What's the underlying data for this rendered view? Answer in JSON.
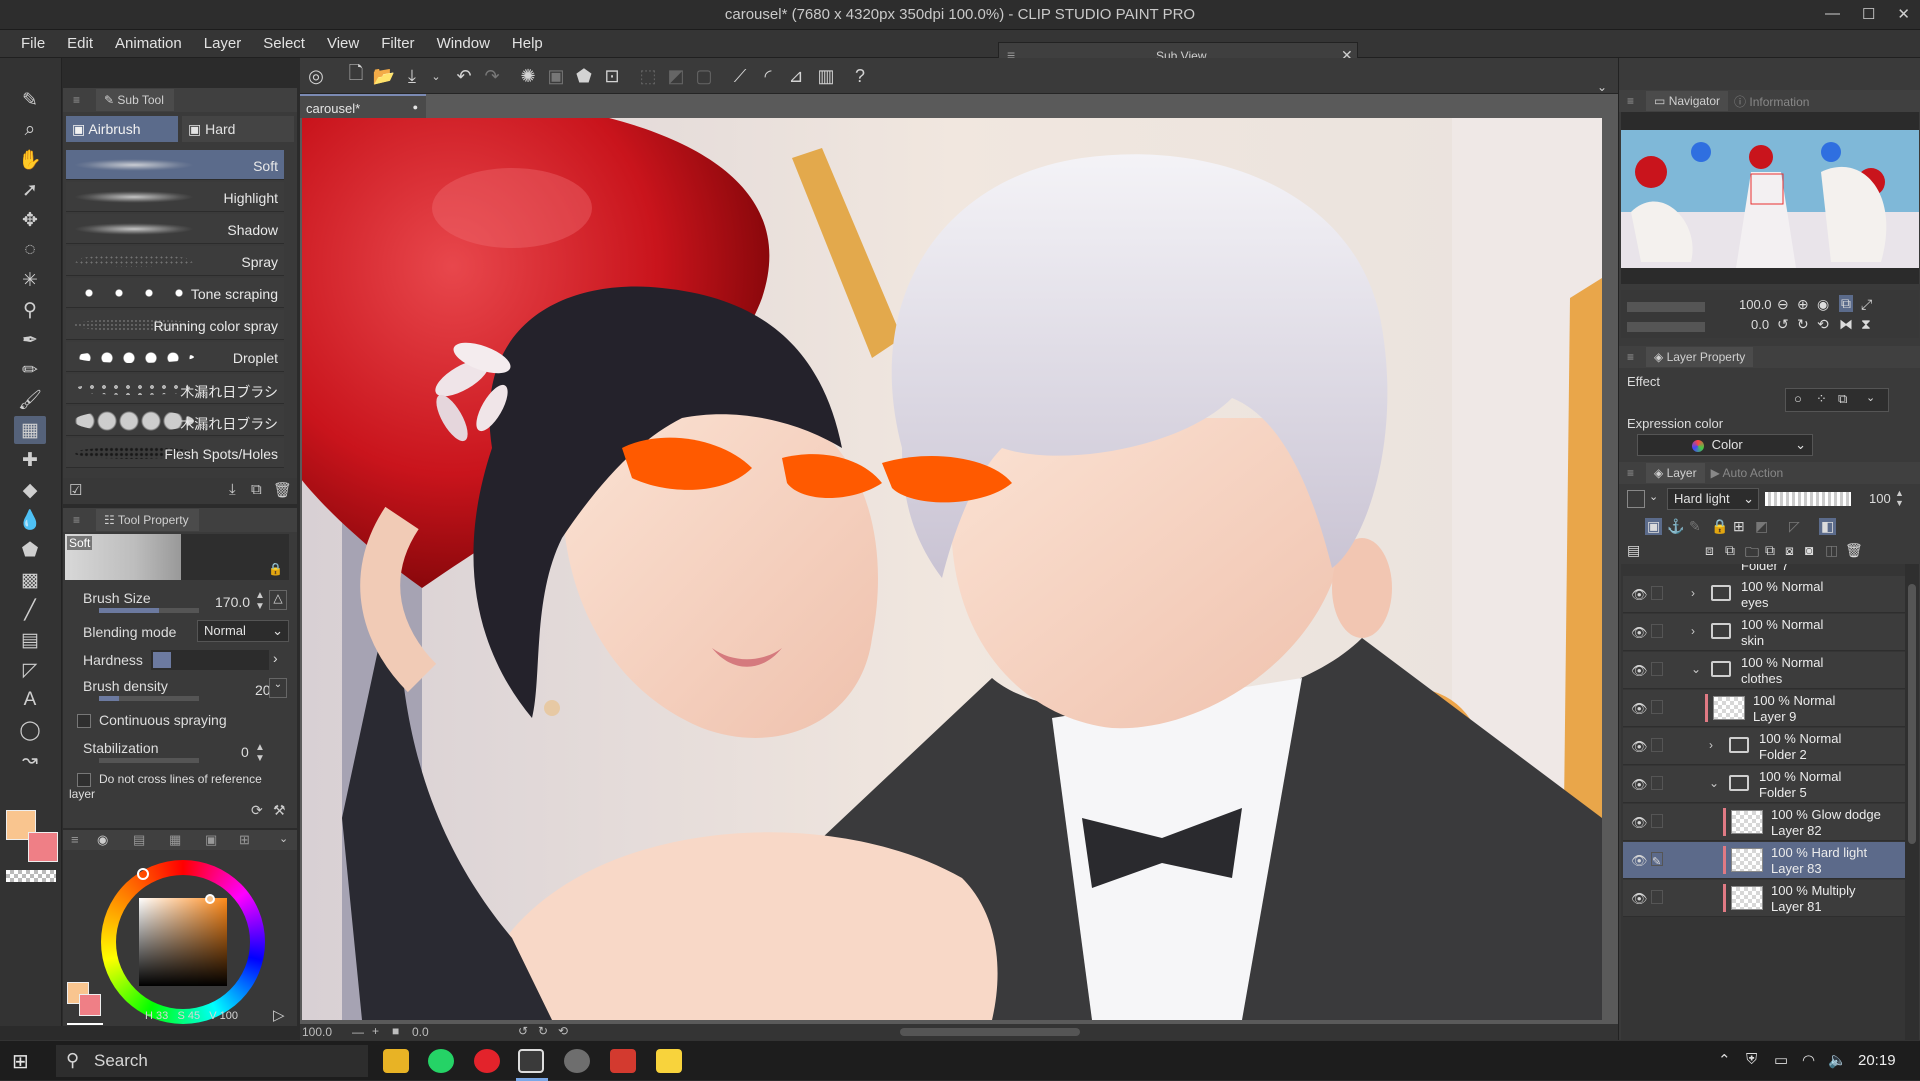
{
  "window": {
    "title": "carousel* (7680 x 4320px 350dpi 100.0%)  - CLIP STUDIO PAINT PRO"
  },
  "menu": [
    "File",
    "Edit",
    "Animation",
    "Layer",
    "Select",
    "View",
    "Filter",
    "Window",
    "Help"
  ],
  "subview": {
    "title": "Sub View"
  },
  "subtool": {
    "panel_title": "Sub Tool",
    "groups": [
      "Airbrush",
      "Hard"
    ],
    "brushes": [
      "Soft",
      "Highlight",
      "Shadow",
      "Spray",
      "Tone scraping",
      "Running color spray",
      "Droplet",
      "木漏れ日ブラシ",
      "木漏れ日ブラシ",
      "Flesh Spots/Holes"
    ]
  },
  "tool_property": {
    "panel_title": "Tool Property",
    "preset_name": "Soft",
    "brush_size_label": "Brush Size",
    "brush_size_value": "170.0",
    "blending_label": "Blending mode",
    "blending_value": "Normal",
    "hardness_label": "Hardness",
    "density_label": "Brush density",
    "density_value": "20",
    "continuous_label": "Continuous spraying",
    "stabilization_label": "Stabilization",
    "stabilization_value": "0",
    "reference_label": "Do not cross lines of reference layer"
  },
  "color": {
    "main": "#f9c58f",
    "sub": "#ef7f86",
    "readout_h": "33",
    "readout_s": "45",
    "readout_v": "100",
    "readout_h_label": "H",
    "readout_s_label": "S",
    "readout_v_label": "V"
  },
  "document": {
    "tab_name": "carousel*",
    "zoom": "100.0",
    "angle": "0.0"
  },
  "navigator": {
    "tabs": [
      "Navigator",
      "Information"
    ],
    "zoom": "100.0",
    "angle": "0.0"
  },
  "layer_property": {
    "title": "Layer Property",
    "effect_label": "Effect",
    "expression_label": "Expression color",
    "expression_value": "Color"
  },
  "layer_panel": {
    "tabs": [
      "Layer",
      "Auto Action"
    ],
    "blend_mode": "Hard light",
    "opacity": "100",
    "top_partial": "Folder 7",
    "layers": [
      {
        "line1": "100 % Normal",
        "line2": "eyes",
        "kind": "folder",
        "indent": 0,
        "expanded": false,
        "selected": false
      },
      {
        "line1": "100 % Normal",
        "line2": "skin",
        "kind": "folder",
        "indent": 0,
        "expanded": false,
        "selected": false
      },
      {
        "line1": "100 % Normal",
        "line2": "clothes",
        "kind": "folder",
        "indent": 0,
        "expanded": true,
        "selected": false
      },
      {
        "line1": "100 % Normal",
        "line2": "Layer 9",
        "kind": "raster",
        "indent": 1,
        "expanded": false,
        "selected": false
      },
      {
        "line1": "100 % Normal",
        "line2": "Folder 2",
        "kind": "folder",
        "indent": 1,
        "expanded": false,
        "selected": false
      },
      {
        "line1": "100 % Normal",
        "line2": "Folder 5",
        "kind": "folder",
        "indent": 1,
        "expanded": true,
        "selected": false
      },
      {
        "line1": "100 % Glow dodge",
        "line2": "Layer 82",
        "kind": "raster",
        "indent": 2,
        "expanded": false,
        "selected": false
      },
      {
        "line1": "100 % Hard light",
        "line2": "Layer 83",
        "kind": "raster",
        "indent": 2,
        "expanded": false,
        "selected": true
      },
      {
        "line1": "100 % Multiply",
        "line2": "Layer 81",
        "kind": "raster",
        "indent": 2,
        "expanded": false,
        "selected": false
      }
    ]
  },
  "taskbar": {
    "search_label": "Search",
    "time": "20:19"
  },
  "colors": {
    "accent": "#5b6b8b",
    "balloon": "#c9141c",
    "scribble": "#ff5a00"
  }
}
